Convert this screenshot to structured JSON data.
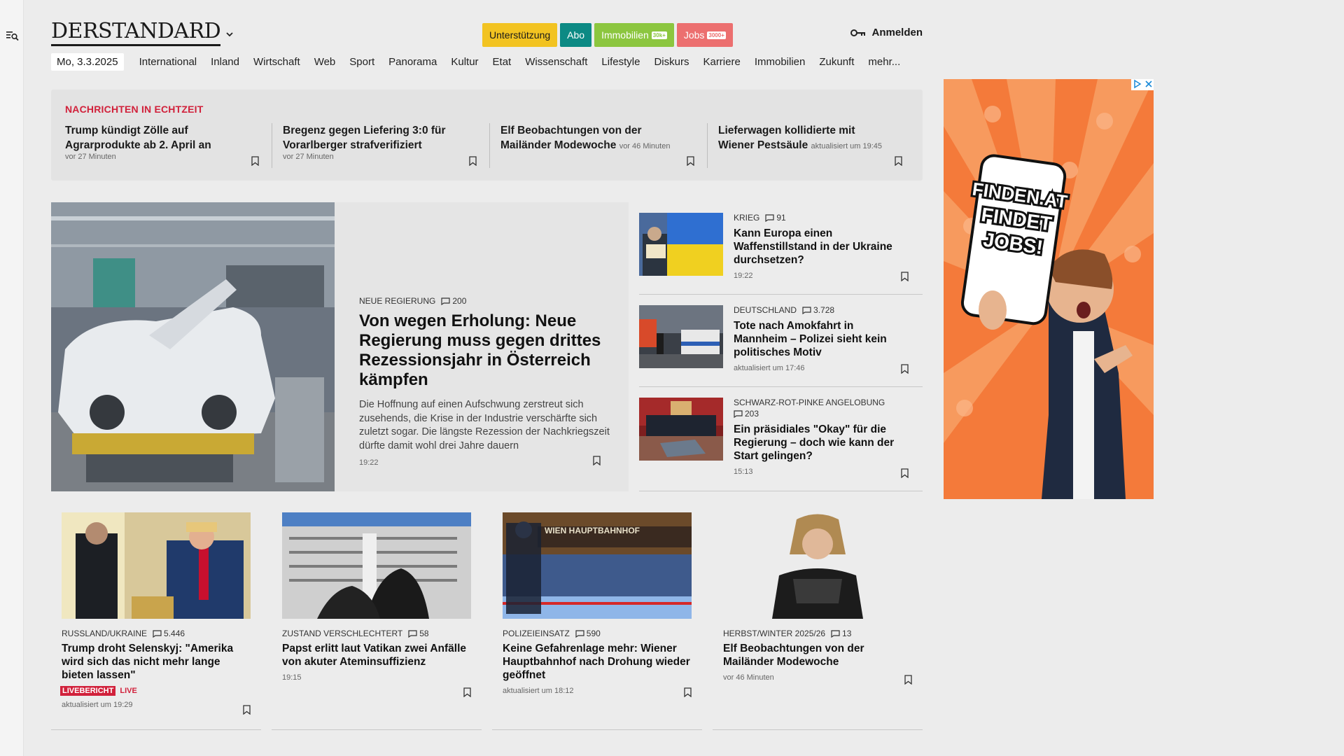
{
  "sidebar": {
    "menu_icon": "menu-search-icon"
  },
  "header": {
    "logo": "DERSTANDARD",
    "buttons": [
      {
        "label": "Unterstützung",
        "bg": "#f2c321",
        "color": "#1a1a1a"
      },
      {
        "label": "Abo",
        "bg": "#0c8a84",
        "color": "#ffffff"
      },
      {
        "label": "Immobilien",
        "tag": "30k+",
        "bg": "#8cc63f",
        "color": "#ffffff"
      },
      {
        "label": "Jobs",
        "tag": "3000+",
        "bg": "#ec6f6f",
        "color": "#ffffff"
      }
    ],
    "login": "Anmelden"
  },
  "nav": {
    "date": "Mo, 3.3.2025",
    "items": [
      "International",
      "Inland",
      "Wirtschaft",
      "Web",
      "Sport",
      "Panorama",
      "Kultur",
      "Etat",
      "Wissenschaft",
      "Lifestyle",
      "Diskurs",
      "Karriere",
      "Immobilien",
      "Zukunft",
      "mehr..."
    ]
  },
  "ticker": {
    "title": "NACHRICHTEN IN ECHTZEIT",
    "items": [
      {
        "title": "Trump kündigt Zölle auf Agrarprodukte ab 2. April an",
        "meta": "vor 27 Minuten"
      },
      {
        "title": "Bregenz gegen Liefering 3:0 für Vorarlberger strafverifiziert",
        "meta": "vor 27 Minuten"
      },
      {
        "title": "Elf Beobachtungen von der Mailänder Modewoche",
        "meta": "vor 46 Minuten"
      },
      {
        "title": "Lieferwagen kollidierte mit Wiener Pestsäule",
        "meta": "aktualisiert um 19:45"
      }
    ]
  },
  "hero": {
    "kicker": "NEUE REGIERUNG",
    "comments": "200",
    "title": "Von wegen Erholung: Neue Regierung muss gegen drittes Rezessionsjahr in Österreich kämpfen",
    "teaser": "Die Hoffnung auf einen Aufschwung zerstreut sich zusehends, die Krise in der Industrie verschärfte sich zuletzt sogar. Die längste Rezession der Nachkriegszeit dürfte damit wohl drei Jahre dauern",
    "time": "19:22"
  },
  "side": [
    {
      "kicker": "KRIEG",
      "comments": "91",
      "title": "Kann Europa einen Waffenstillstand in der Ukraine durchsetzen?",
      "time": "19:22"
    },
    {
      "kicker": "DEUTSCHLAND",
      "comments": "3.728",
      "title": "Tote nach Amokfahrt in Mannheim – Polizei sieht kein politisches Motiv",
      "time": "aktualisiert um 17:46"
    },
    {
      "kicker": "SCHWARZ-ROT-PINKE ANGELOBUNG",
      "comments": "203",
      "title": "Ein präsidiales \"Okay\" für die Regierung – doch wie kann der Start gelingen?",
      "time": "15:13"
    }
  ],
  "cards": [
    {
      "kicker": "RUSSLAND/UKRAINE",
      "comments": "5.446",
      "title": "Trump droht Selenskyj: \"Amerika wird sich das nicht mehr lange bieten lassen\"",
      "badge": "LIVEBERICHT",
      "live": "LIVE",
      "time": "aktualisiert um 19:29"
    },
    {
      "kicker": "ZUSTAND VERSCHLECHTERT",
      "comments": "58",
      "title": "Papst erlitt laut Vatikan zwei Anfälle von akuter Ateminsuffizienz",
      "time": "19:15"
    },
    {
      "kicker": "POLIZEIEINSATZ",
      "comments": "590",
      "title": "Keine Gefahrenlage mehr: Wiener Hauptbahnhof nach Drohung wieder geöffnet",
      "time": "aktualisiert um 18:12",
      "image_sign": "WIEN HAUPTBAHNHOF"
    },
    {
      "kicker": "HERBST/WINTER 2025/26",
      "comments": "13",
      "title": "Elf Beobachtungen von der Mailänder Modewoche",
      "time": "vor 46 Minuten"
    }
  ],
  "ad": {
    "text_lines": [
      "FINDEN.AT",
      "FINDET",
      "JOBS!"
    ],
    "bg": "#f47a3a"
  },
  "colors": {
    "accent_red": "#d1213b",
    "page_bg": "#ececec"
  }
}
